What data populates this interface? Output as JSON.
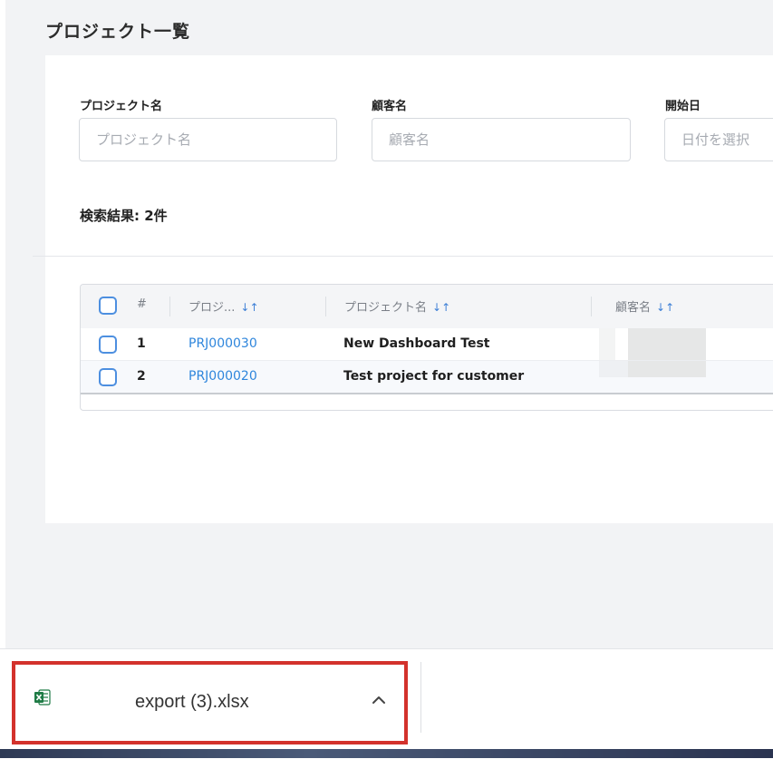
{
  "page": {
    "title": "プロジェクト一覧"
  },
  "filters": {
    "project_name": {
      "label": "プロジェクト名",
      "placeholder": "プロジェクト名"
    },
    "customer_name": {
      "label": "顧客名",
      "placeholder": "顧客名"
    },
    "start_date": {
      "label": "開始日",
      "placeholder": "日付を選択"
    }
  },
  "results": {
    "count_text": "検索結果: 2件"
  },
  "table": {
    "headers": {
      "index": "#",
      "project_code": "プロジ...",
      "project_name": "プロジェクト名",
      "customer_name": "顧客名",
      "sort_glyph": "↓↑"
    },
    "rows": [
      {
        "index": "1",
        "project_code": "PRJ000030",
        "project_name": "New Dashboard Test"
      },
      {
        "index": "2",
        "project_code": "PRJ000020",
        "project_name": "Test project for customer"
      }
    ]
  },
  "download_bar": {
    "file_name": "export (3).xlsx",
    "icon": "excel-file-icon",
    "highlight_color": "#d3322c"
  },
  "colors": {
    "link": "#2f86dc",
    "checkbox": "#4d8fe0"
  }
}
